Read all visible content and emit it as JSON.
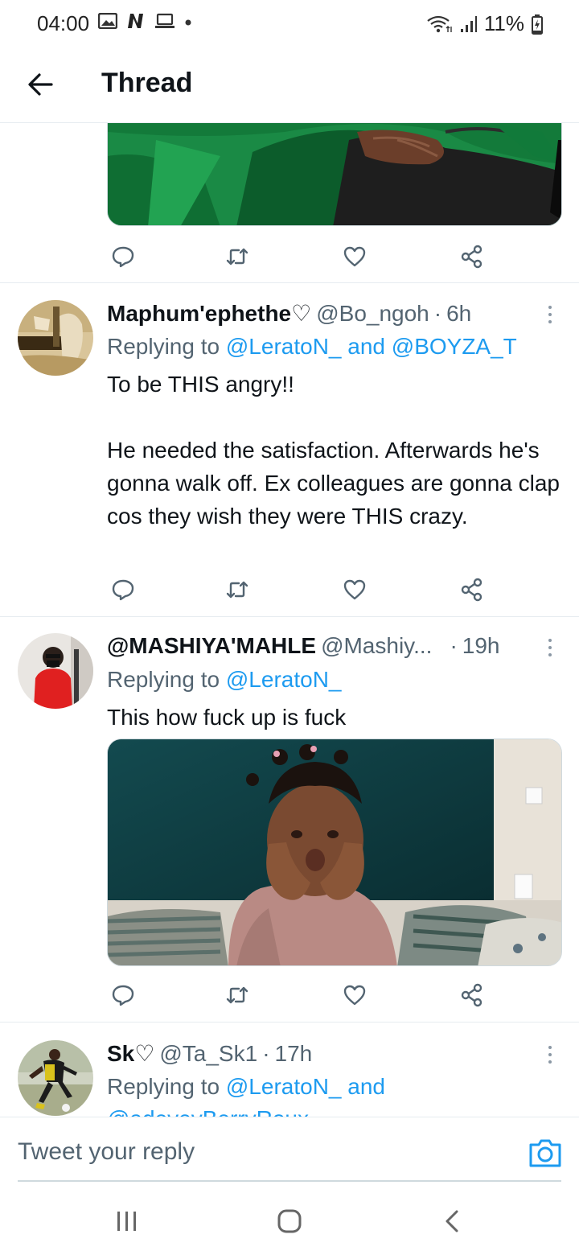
{
  "status_bar": {
    "time": "04:00",
    "battery": "11%",
    "left_icons": [
      "gallery-icon",
      "netflix-n-icon",
      "laptop-icon",
      "dot-icon"
    ],
    "right_icons": [
      "wifi-icon",
      "signal-icon",
      "battery-charging-icon"
    ]
  },
  "header": {
    "title": "Thread",
    "back_icon": "arrow-left-icon"
  },
  "tweets": [
    {
      "name": "Maphum'ephethe♡",
      "handle": "@Bo_ngoh",
      "time": "6h",
      "replying_prefix": "Replying to",
      "mentions": [
        "@LeratoN_",
        "@BOYZA_T"
      ],
      "joiner": "and",
      "text": "To be THIS angry!!\n\nHe needed the satisfaction. Afterwards he's gonna walk off. Ex colleagues are gonna clap cos they wish they were THIS crazy."
    },
    {
      "name": "@MASHIYA'MAHLE",
      "handle": "@Mashiy...",
      "time": "19h",
      "replying_prefix": "Replying to",
      "mentions": [
        "@LeratoN_"
      ],
      "text": "This how fuck up is fuck"
    },
    {
      "name": "Sk♡",
      "handle": "@Ta_Sk1",
      "time": "17h",
      "replying_prefix": "Replying to",
      "mentions": [
        "@LeratoN_"
      ],
      "joiner": "and",
      "mention_cutoff": "@adeveyBerryRoux"
    }
  ],
  "action_icons": [
    "reply-icon",
    "retweet-icon",
    "like-icon",
    "share-icon"
  ],
  "reply_bar": {
    "placeholder": "Tweet your reply",
    "icon": "camera-icon"
  },
  "nav_bar": {
    "icons": [
      "recent-apps-icon",
      "home-icon",
      "back-icon"
    ]
  },
  "colors": {
    "accent": "#1d9bf0",
    "text": "#0f1419",
    "secondary": "#536471",
    "divider": "#e6ecf0"
  }
}
